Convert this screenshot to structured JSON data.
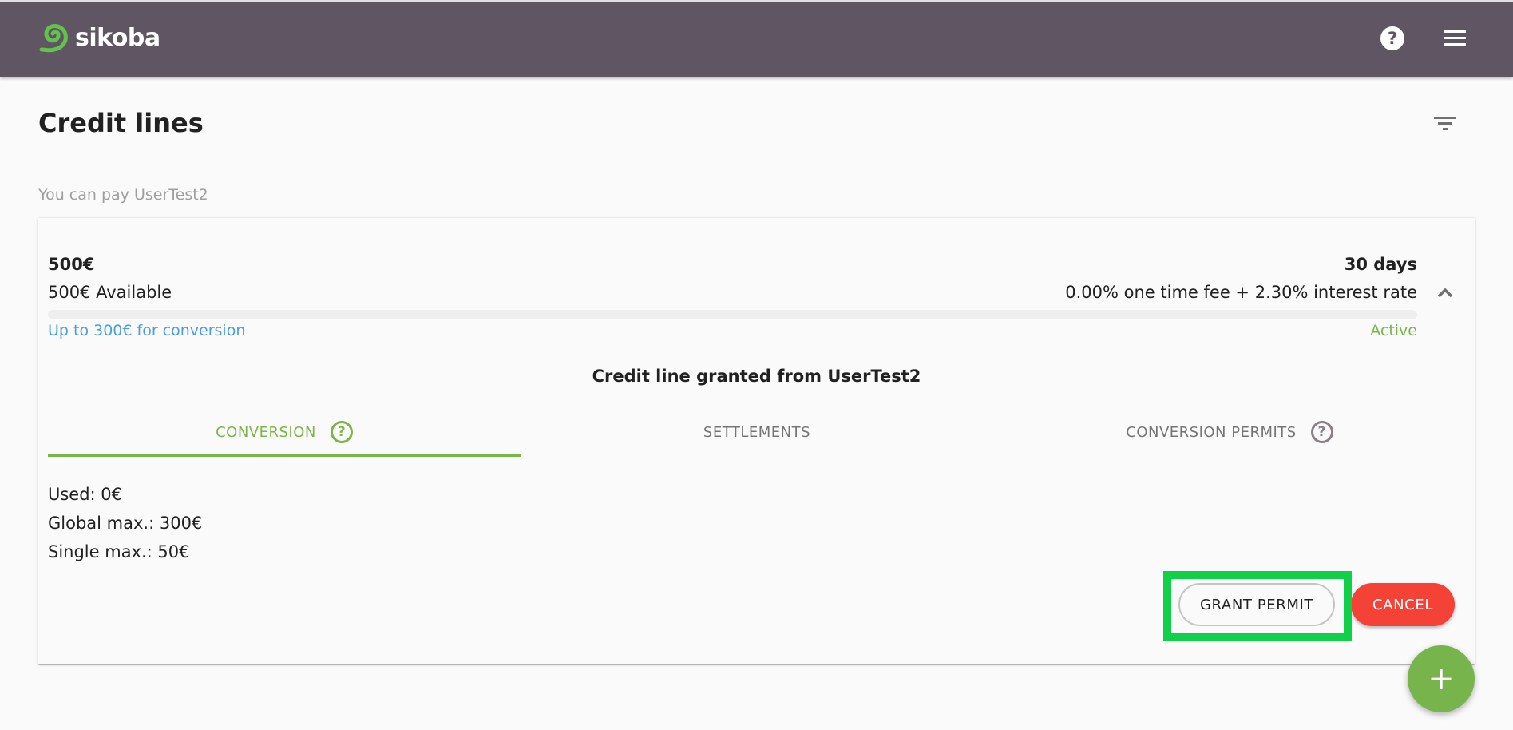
{
  "app": {
    "brand": "sikoba",
    "colors": {
      "header_bg": "#5f5563",
      "accent_green": "#7ab648",
      "link_blue": "#4a9ee0",
      "danger_red": "#f44336",
      "highlight": "#10d04a"
    }
  },
  "header": {
    "help_icon": "help-circle-icon",
    "menu_icon": "hamburger-menu-icon"
  },
  "page": {
    "title": "Credit lines",
    "filter_icon": "filter-icon",
    "section_label": "You can pay UserTest2"
  },
  "credit_line": {
    "amount": "500€",
    "available": "500€ Available",
    "duration": "30 days",
    "fees": "0.00% one time fee + 2.30% interest rate",
    "used_fraction": 0,
    "conversion_limit": "Up to 300€ for conversion",
    "status": "Active",
    "collapse_icon": "chevron-up-icon",
    "granted_title": "Credit line granted from UserTest2",
    "tabs": [
      {
        "label": "CONVERSION",
        "active": true,
        "has_help": true
      },
      {
        "label": "SETTLEMENTS",
        "active": false,
        "has_help": false
      },
      {
        "label": "CONVERSION PERMITS",
        "active": false,
        "has_help": true
      }
    ],
    "stats": {
      "used": "Used: 0€",
      "global_max": "Global max.: 300€",
      "single_max": "Single max.: 50€"
    },
    "actions": {
      "grant_permit": "GRANT PERMIT",
      "cancel": "CANCEL"
    }
  },
  "fab": {
    "label": "+",
    "icon": "plus-icon"
  }
}
